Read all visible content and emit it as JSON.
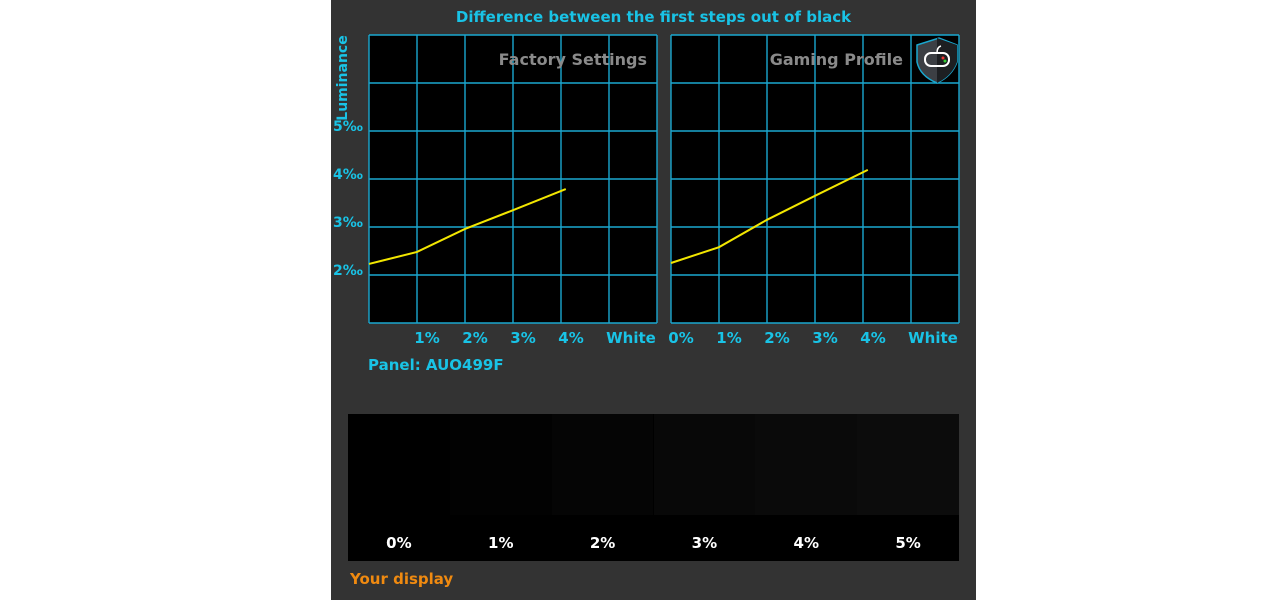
{
  "title": "Difference between the first steps out of black",
  "panel_label": "Panel: AUO499F",
  "your_display_label": "Your display",
  "colors": {
    "accent": "#19c3e6",
    "line": "#f2e600",
    "orange": "#f08a10",
    "background": "#333333"
  },
  "chart_data": [
    {
      "type": "line",
      "title": "Factory Settings",
      "ylabel": "Luminance",
      "x_tick_labels": [
        "1%",
        "2%",
        "3%",
        "4%",
        "White"
      ],
      "y_tick_labels": [
        "5‰",
        "4‰",
        "3‰",
        "2‰"
      ],
      "xlim": [
        0,
        6
      ],
      "ylim": [
        1,
        7
      ],
      "grid": true,
      "x": [
        0,
        1,
        2,
        3,
        4.1
      ],
      "y": [
        2.23,
        2.48,
        2.96,
        3.35,
        3.79
      ]
    },
    {
      "type": "line",
      "title": "Gaming Profile",
      "icon": "gamepad-shield-icon",
      "x_tick_labels": [
        "0%",
        "1%",
        "2%",
        "3%",
        "4%",
        "White"
      ],
      "xlim": [
        0,
        6
      ],
      "ylim": [
        1,
        7
      ],
      "grid": true,
      "x": [
        0,
        1,
        2,
        3,
        4.1
      ],
      "y": [
        2.25,
        2.58,
        3.15,
        3.65,
        4.19
      ]
    }
  ],
  "swatches": [
    {
      "label": "0%",
      "color": "#000000"
    },
    {
      "label": "1%",
      "color": "#020202"
    },
    {
      "label": "2%",
      "color": "#050505"
    },
    {
      "label": "3%",
      "color": "#080808"
    },
    {
      "label": "4%",
      "color": "#0a0a0a"
    },
    {
      "label": "5%",
      "color": "#0c0c0c"
    }
  ]
}
